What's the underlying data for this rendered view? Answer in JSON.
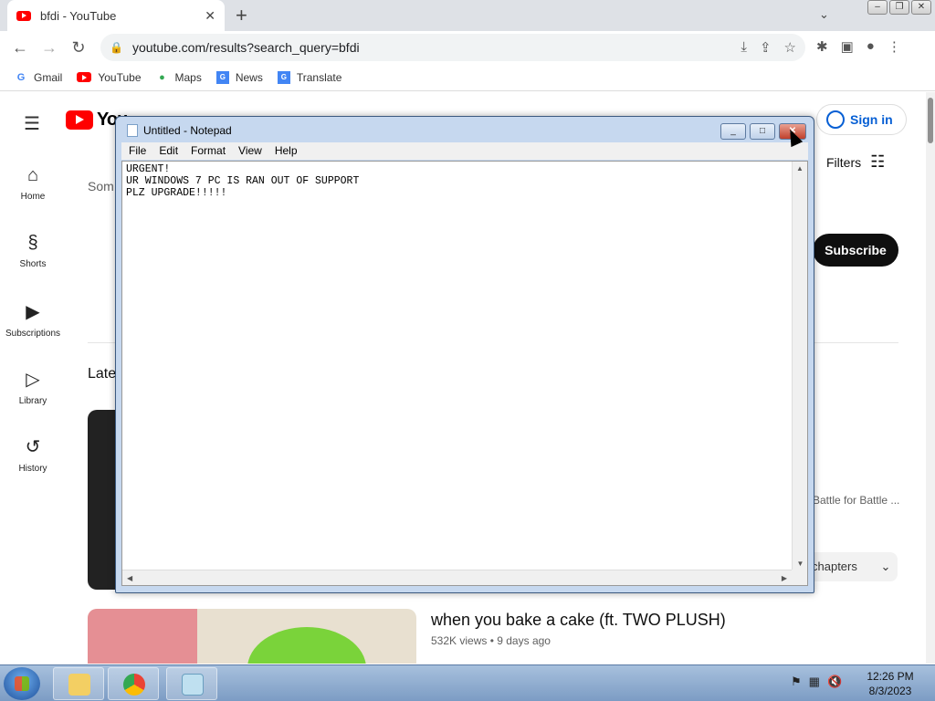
{
  "browser": {
    "tab_title": "bfdi - YouTube",
    "url": "youtube.com/results?search_query=bfdi",
    "bookmarks": [
      "Gmail",
      "YouTube",
      "Maps",
      "News",
      "Translate"
    ]
  },
  "youtube": {
    "logo_text": "You",
    "sign_in": "Sign in",
    "sidebar": [
      {
        "label": "Home",
        "icon": "home-icon"
      },
      {
        "label": "Shorts",
        "icon": "shorts-icon"
      },
      {
        "label": "Subscriptions",
        "icon": "subscriptions-icon"
      },
      {
        "label": "Library",
        "icon": "library-icon"
      },
      {
        "label": "History",
        "icon": "history-icon"
      }
    ],
    "filters": "Filters",
    "subscribe": "Subscribe",
    "partial_text_top": "Som",
    "partial_text_section": "Late",
    "battle_snippet": "Battle for Battle ...",
    "chapters": "chapters",
    "video": {
      "title": "when you bake a cake (ft. TWO PLUSH)",
      "views": "532K views",
      "age": "9 days ago"
    }
  },
  "notepad": {
    "title": "Untitled - Notepad",
    "menu": [
      "File",
      "Edit",
      "Format",
      "View",
      "Help"
    ],
    "content": "URGENT!\nUR WINDOWS 7 PC IS RAN OUT OF SUPPORT\nPLZ UPGRADE!!!!!"
  },
  "taskbar": {
    "time": "12:26 PM",
    "date": "8/3/2023"
  },
  "colors": {
    "youtube_red": "#ff0000",
    "link_blue": "#065fd4"
  }
}
